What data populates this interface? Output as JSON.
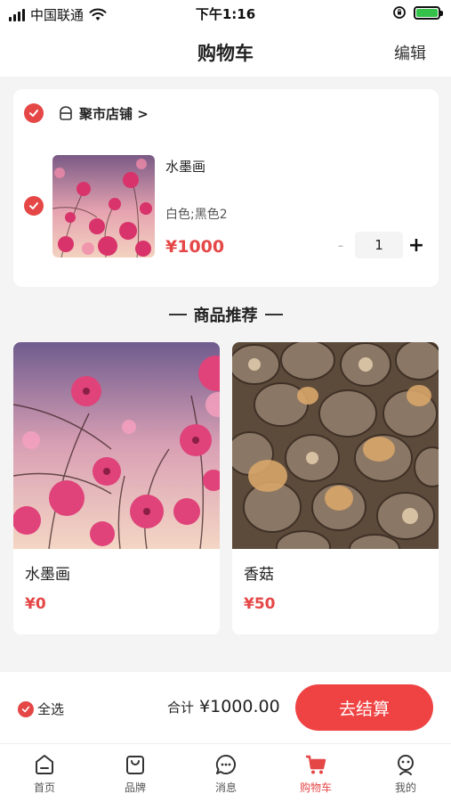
{
  "status_bar": {
    "carrier": "中国联通",
    "time": "下午1:16"
  },
  "header": {
    "title": "购物车",
    "edit_label": "编辑"
  },
  "cart": {
    "shop_name": "聚市店铺 >",
    "item": {
      "name": "水墨画",
      "spec": "白色;黑色2",
      "price": "¥1000",
      "minus": "-",
      "quantity": "1",
      "plus": "+"
    }
  },
  "recommend": {
    "title": "商品推荐",
    "products": [
      {
        "name": "水墨画",
        "price": "¥0"
      },
      {
        "name": "香菇",
        "price": "¥50"
      }
    ]
  },
  "checkout": {
    "select_all_label": "全选",
    "total_label": "合计",
    "total_value": "¥1000.00",
    "button_label": "去结算"
  },
  "tabs": [
    {
      "label": "首页",
      "icon": "home-icon"
    },
    {
      "label": "品牌",
      "icon": "bag-icon"
    },
    {
      "label": "消息",
      "icon": "message-icon"
    },
    {
      "label": "购物车",
      "icon": "cart-icon",
      "active": true
    },
    {
      "label": "我的",
      "icon": "profile-icon"
    }
  ],
  "colors": {
    "accent": "#e54747",
    "checkout_button": "#ef4343",
    "background": "#f4f4f4"
  }
}
